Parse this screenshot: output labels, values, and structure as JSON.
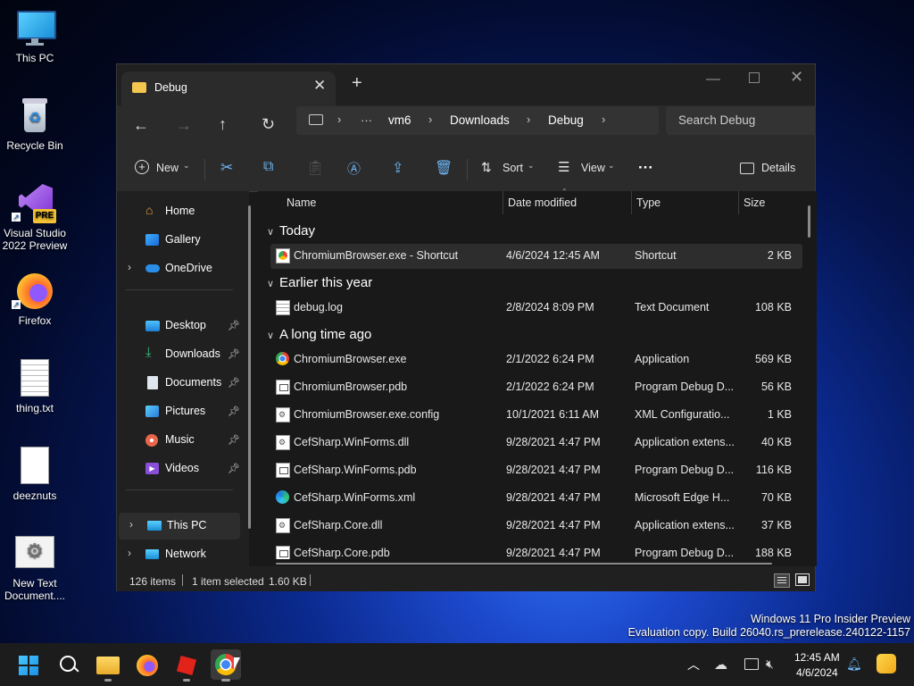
{
  "desktop": {
    "icons": [
      {
        "label": "This PC"
      },
      {
        "label": "Recycle Bin"
      },
      {
        "label": "Visual Studio 2022 Preview"
      },
      {
        "label": "Firefox"
      },
      {
        "label": "thing.txt"
      },
      {
        "label": "deeznuts"
      },
      {
        "label": "New Text Document...."
      }
    ],
    "vs_badge": "PRE",
    "watermark_line1": "Windows 11 Pro Insider Preview",
    "watermark_line2": "Evaluation copy. Build 26040.rs_prerelease.240122-1157"
  },
  "window": {
    "tab_title": "Debug",
    "new_tab": "+",
    "breadcrumb": [
      "vm6",
      "Downloads",
      "Debug"
    ],
    "breadcrumb_more": "···",
    "search_placeholder": "Search Debug",
    "toolbar": {
      "new_label": "New",
      "sort_label": "Sort",
      "view_label": "View",
      "more_label": "···",
      "details_label": "Details"
    },
    "nav": [
      {
        "label": "Home",
        "icon": "home-icon"
      },
      {
        "label": "Gallery",
        "icon": "gallery-icon"
      },
      {
        "label": "OneDrive",
        "icon": "onedrive-icon"
      },
      {
        "label": "Desktop",
        "icon": "desktop-icon"
      },
      {
        "label": "Downloads",
        "icon": "downloads-icon"
      },
      {
        "label": "Documents",
        "icon": "documents-icon"
      },
      {
        "label": "Pictures",
        "icon": "pictures-icon"
      },
      {
        "label": "Music",
        "icon": "music-icon"
      },
      {
        "label": "Videos",
        "icon": "videos-icon"
      },
      {
        "label": "This PC",
        "icon": "this-pc-icon"
      },
      {
        "label": "Network",
        "icon": "network-icon"
      }
    ],
    "columns": [
      "Name",
      "Date modified",
      "Type",
      "Size"
    ],
    "groups": [
      {
        "title": "Today"
      },
      {
        "title": "Earlier this year"
      },
      {
        "title": "A long time ago"
      }
    ],
    "files": [
      {
        "name": "ChromiumBrowser.exe - Shortcut",
        "date": "4/6/2024 12:45 AM",
        "type": "Shortcut",
        "size": "2 KB",
        "icon": "chrome-shortcut-icon"
      },
      {
        "name": "debug.log",
        "date": "2/8/2024 8:09 PM",
        "type": "Text Document",
        "size": "108 KB",
        "icon": "text-file-icon"
      },
      {
        "name": "ChromiumBrowser.exe",
        "date": "2/1/2022 6:24 PM",
        "type": "Application",
        "size": "569 KB",
        "icon": "chrome-icon"
      },
      {
        "name": "ChromiumBrowser.pdb",
        "date": "2/1/2022 6:24 PM",
        "type": "Program Debug D...",
        "size": "56 KB",
        "icon": "pdb-file-icon"
      },
      {
        "name": "ChromiumBrowser.exe.config",
        "date": "10/1/2021 6:11 AM",
        "type": "XML Configuratio...",
        "size": "1 KB",
        "icon": "config-file-icon"
      },
      {
        "name": "CefSharp.WinForms.dll",
        "date": "9/28/2021 4:47 PM",
        "type": "Application extens...",
        "size": "40 KB",
        "icon": "dll-file-icon"
      },
      {
        "name": "CefSharp.WinForms.pdb",
        "date": "9/28/2021 4:47 PM",
        "type": "Program Debug D...",
        "size": "116 KB",
        "icon": "pdb-file-icon"
      },
      {
        "name": "CefSharp.WinForms.xml",
        "date": "9/28/2021 4:47 PM",
        "type": "Microsoft Edge H...",
        "size": "70 KB",
        "icon": "edge-icon"
      },
      {
        "name": "CefSharp.Core.dll",
        "date": "9/28/2021 4:47 PM",
        "type": "Application extens...",
        "size": "37 KB",
        "icon": "dll-file-icon"
      },
      {
        "name": "CefSharp.Core.pdb",
        "date": "9/28/2021 4:47 PM",
        "type": "Program Debug D...",
        "size": "188 KB",
        "icon": "pdb-file-icon"
      }
    ],
    "status": {
      "count": "126 items",
      "selected": "1 item selected",
      "size": "1.60 KB"
    }
  },
  "taskbar": {
    "time": "12:45 AM",
    "date": "4/6/2024"
  },
  "colors": {
    "accent": "#0078d4",
    "selection": "#2d2d2d",
    "window_bg": "#191919"
  }
}
